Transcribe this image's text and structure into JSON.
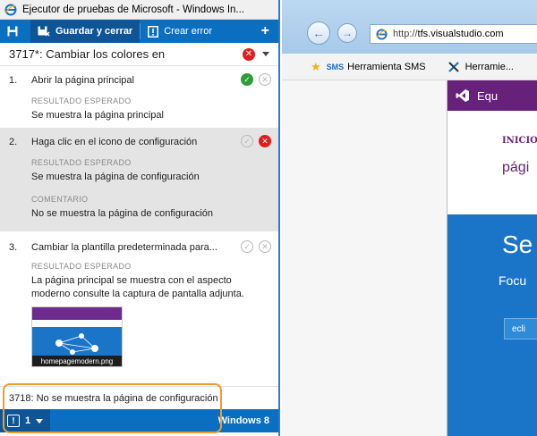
{
  "runner": {
    "window_title": "Ejecutor de pruebas de Microsoft - Windows In...",
    "toolbar": {
      "save_close_label": "Guardar y cerrar",
      "create_bug_label": "Crear error",
      "add_label": "+"
    },
    "test_case": {
      "title": "3717*: Cambiar los colores en",
      "status": "failed"
    },
    "steps": [
      {
        "number": "1.",
        "action": "Abrir la página principal",
        "expected_label": "RESULTADO ESPERADO",
        "expected": "Se muestra la página principal",
        "status": "passed"
      },
      {
        "number": "2.",
        "action": "Haga clic en el icono de configuración",
        "expected_label": "RESULTADO ESPERADO",
        "expected": "Se muestra la página de configuración",
        "comment_label": "COMENTARIO",
        "comment": "No se muestra la página de configuración",
        "status": "failed",
        "selected": true
      },
      {
        "number": "3.",
        "action": "Cambiar la plantilla predeterminada para...",
        "expected_label": "RESULTADO ESPERADO",
        "expected": "La página principal se muestra con el aspecto moderno consulte la captura de pantalla adjunta.",
        "attachment": "homepagemodern.png",
        "status": "none"
      }
    ],
    "bug_link": "3718: No se muestra la página de configuración",
    "status_bar": {
      "bug_count": "1",
      "os_label": "Windows 8"
    }
  },
  "browser": {
    "url_prefix": "http://",
    "url_host": "tfs.visualstudio.com",
    "favorites": [
      {
        "prefix": "SMS",
        "label": "Herramienta SMS"
      },
      {
        "prefix": "",
        "label": "Herramie..."
      }
    ],
    "page": {
      "header_text": "Equ",
      "nav_item": "INICIO",
      "heading": "pági",
      "hero_big": "Se",
      "hero_sub": "Focu",
      "hero_button": "ecli"
    }
  },
  "colors": {
    "accent_blue": "#0a6fc1",
    "fail_red": "#e21b1b",
    "pass_green": "#2d9d3a",
    "highlight_orange": "#f29b2a",
    "vs_purple": "#68217a"
  }
}
